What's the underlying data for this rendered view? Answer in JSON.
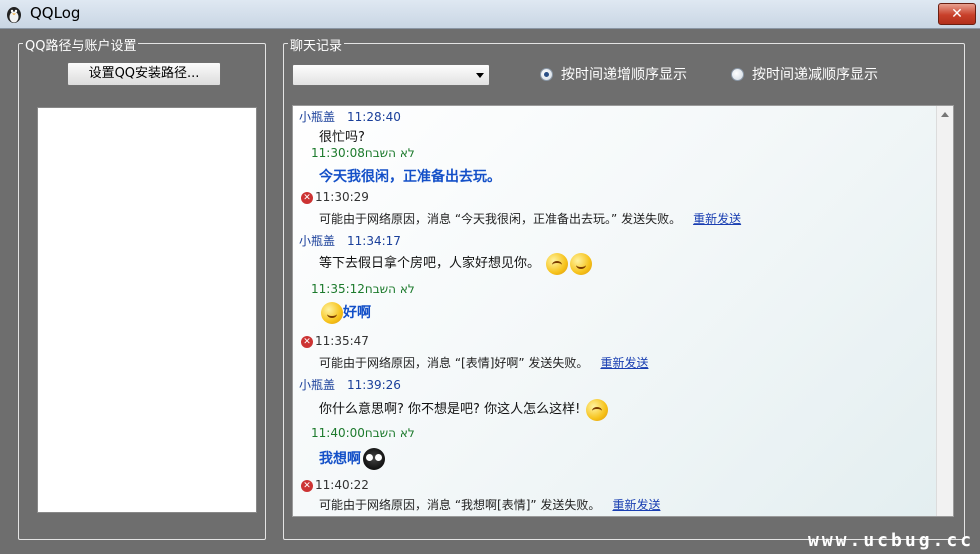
{
  "window": {
    "title": "QQLog",
    "close_label": "✕"
  },
  "left_panel": {
    "group_label": "QQ路径与账户设置",
    "set_path_button": "设置QQ安装路径..."
  },
  "right_panel": {
    "group_label": "聊天记录",
    "dropdown_value": "",
    "radio_asc": "按时间递增顺序显示",
    "radio_desc": "按时间递减顺序显示",
    "order_selected": "asc"
  },
  "chat": {
    "m1": {
      "name": "小瓶盖",
      "time": "11:28:40",
      "text": "很忙吗?"
    },
    "m2": {
      "name": "לא השבח",
      "time": "11:30:08",
      "text": "今天我很闲，正准备出去玩。"
    },
    "e1": {
      "time": "11:30:29",
      "text": "可能由于网络原因，消息 “今天我很闲，正准备出去玩。” 发送失败。",
      "link": "重新发送"
    },
    "m3": {
      "name": "小瓶盖",
      "time": "11:34:17",
      "text": "等下去假日拿个房吧，人家好想见你。"
    },
    "m4": {
      "name": "לא השבח",
      "time": "11:35:12",
      "text": "好啊"
    },
    "e2": {
      "time": "11:35:47",
      "text": "可能由于网络原因，消息 “[表情]好啊” 发送失败。",
      "link": "重新发送"
    },
    "m5": {
      "name": "小瓶盖",
      "time": "11:39:26",
      "text": "你什么意思啊? 你不想是吧? 你这人怎么这样!"
    },
    "m6": {
      "name": "לא השבח",
      "time": "11:40:00",
      "text": "我想啊"
    },
    "e3": {
      "time": "11:40:22",
      "text": "可能由于网络原因，消息 “我想啊[表情]” 发送失败。",
      "link": "重新发送"
    }
  },
  "watermark": "www.ucbug.cc"
}
